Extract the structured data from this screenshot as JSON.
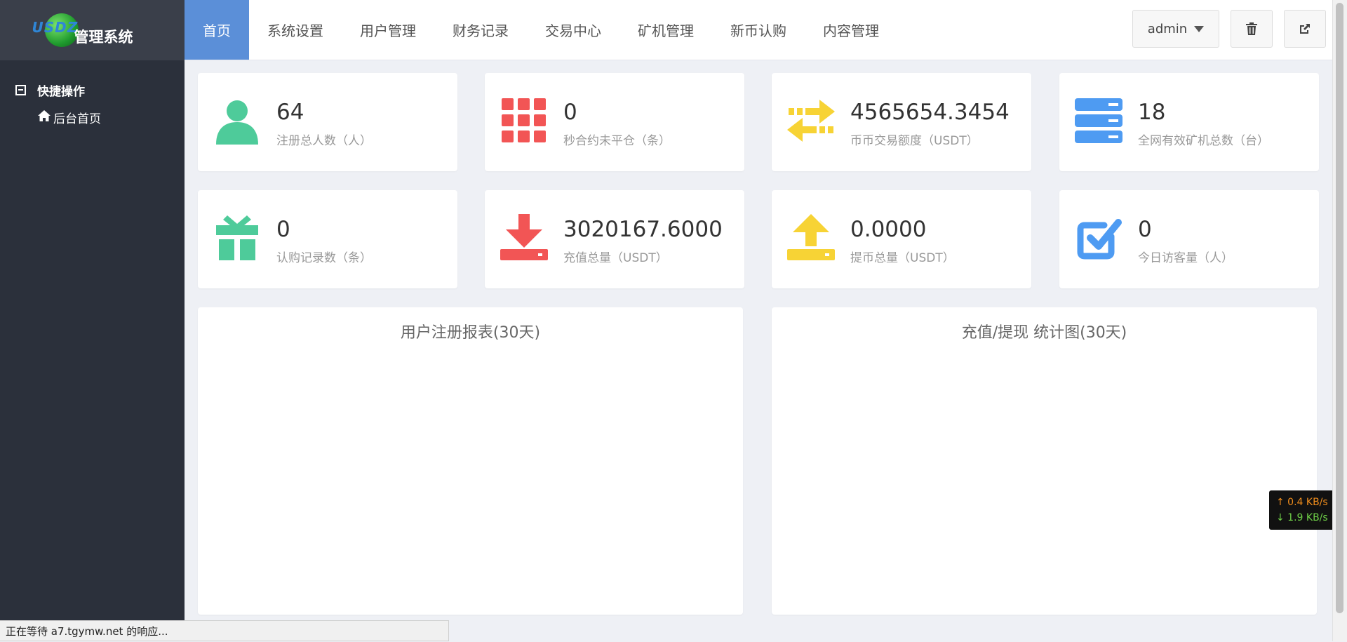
{
  "brand": {
    "logo_text": "USDZ",
    "title": "管理系统"
  },
  "sidebar": {
    "section_label": "快捷操作",
    "items": [
      {
        "label": "后台首页"
      }
    ]
  },
  "nav": {
    "items": [
      {
        "label": "首页",
        "active": true
      },
      {
        "label": "系统设置"
      },
      {
        "label": "用户管理"
      },
      {
        "label": "财务记录"
      },
      {
        "label": "交易中心"
      },
      {
        "label": "矿机管理"
      },
      {
        "label": "新币认购"
      },
      {
        "label": "内容管理"
      }
    ],
    "user_label": "admin"
  },
  "stats": [
    {
      "value": "64",
      "label": "注册总人数（人）",
      "icon": "user-icon",
      "color": "#4ecb9a"
    },
    {
      "value": "0",
      "label": "秒合约未平仓（条）",
      "icon": "grid-icon",
      "color": "#f25555"
    },
    {
      "value": "4565654.3454",
      "label": "币币交易额度（USDT）",
      "icon": "exchange-icon",
      "color": "#f7d335"
    },
    {
      "value": "18",
      "label": "全网有效矿机总数（台）",
      "icon": "server-icon",
      "color": "#4e9bf2"
    },
    {
      "value": "0",
      "label": "认购记录数（条）",
      "icon": "gift-icon",
      "color": "#4ecb9a"
    },
    {
      "value": "3020167.6000",
      "label": "充值总量（USDT）",
      "icon": "download-icon",
      "color": "#f25555"
    },
    {
      "value": "0.0000",
      "label": "提币总量（USDT）",
      "icon": "upload-icon",
      "color": "#f7d335"
    },
    {
      "value": "0",
      "label": "今日访客量（人）",
      "icon": "check-square-icon",
      "color": "#4e9bf2"
    }
  ],
  "panels": [
    {
      "title": "用户注册报表(30天)"
    },
    {
      "title": "充值/提现 统计图(30天)"
    }
  ],
  "speed": {
    "up": "↑ 0.4 KB/s",
    "down": "↓ 1.9 KB/s"
  },
  "status_bar": {
    "text": "正在等待 a7.tgymw.net 的响应..."
  }
}
